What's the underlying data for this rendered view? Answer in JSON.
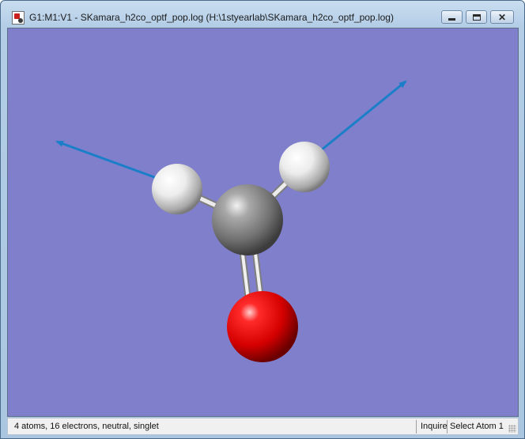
{
  "window": {
    "title": "G1:M1:V1 - SKamara_h2co_optf_pop.log (H:\\1styearlab\\SKamara_h2co_optf_pop.log)",
    "app_icon": "gaussview-document-icon",
    "controls": {
      "minimize_icon": "minimize-icon",
      "maximize_icon": "maximize-icon",
      "close_icon": "close-icon"
    }
  },
  "viewport": {
    "background_color": "#7f7fcb",
    "atoms": [
      {
        "element": "C",
        "color": "#8a8a8a"
      },
      {
        "element": "O",
        "color": "#e00000"
      },
      {
        "element": "H",
        "color": "#f0f0f0"
      },
      {
        "element": "H",
        "color": "#f0f0f0"
      }
    ],
    "vector_color": "#1a7fc8"
  },
  "status": {
    "main": "4 atoms, 16 electrons, neutral, singlet",
    "mode": "Inquire",
    "action": "Select Atom 1"
  }
}
